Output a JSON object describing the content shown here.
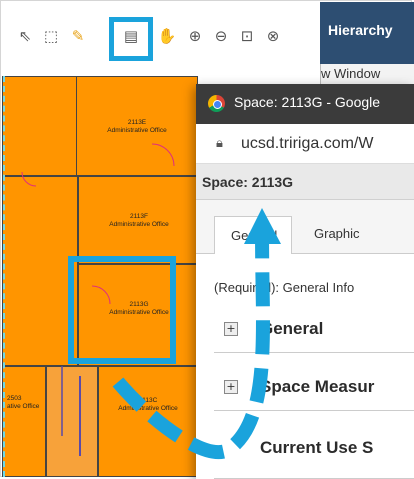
{
  "toolbar": {
    "tools": [
      {
        "icon": "select-arrow-icon",
        "glyph": "⇖"
      },
      {
        "icon": "select-area-icon",
        "glyph": "⬚"
      },
      {
        "icon": "pencil-icon",
        "glyph": "✎"
      },
      {
        "icon": "document-icon",
        "glyph": "▤"
      },
      {
        "icon": "hand-icon",
        "glyph": "✋"
      },
      {
        "icon": "zoom-in-icon",
        "glyph": "⊕"
      },
      {
        "icon": "zoom-out-icon",
        "glyph": "⊖"
      },
      {
        "icon": "zoom-area-icon",
        "glyph": "⊡"
      },
      {
        "icon": "zoom-fit-icon",
        "glyph": "⊗"
      }
    ]
  },
  "hierarchy": {
    "title": "Hierarchy",
    "subtitle": "w Window"
  },
  "floor_plan": {
    "rooms": [
      {
        "id": "2113E",
        "name": "Administrative Office"
      },
      {
        "id": "2113F",
        "name": "Administrative Office"
      },
      {
        "id": "2113G",
        "name": "Administrative Office"
      },
      {
        "id": "2503",
        "name": "ative Office"
      },
      {
        "id": "2113C",
        "name": "Administrative Office"
      }
    ]
  },
  "popup": {
    "window_title": "Space: 2113G - Google",
    "url": "ucsd.tririga.com/W",
    "space_title": "Space: 2113G",
    "tabs": [
      "General",
      "Graphic"
    ],
    "required_text": "(Required): General Info",
    "sections": [
      "General",
      "Space Measur",
      "Current Use S"
    ]
  },
  "colors": {
    "highlight": "#1aa3dc",
    "room": "#ff9500",
    "header": "#2d4e72"
  }
}
